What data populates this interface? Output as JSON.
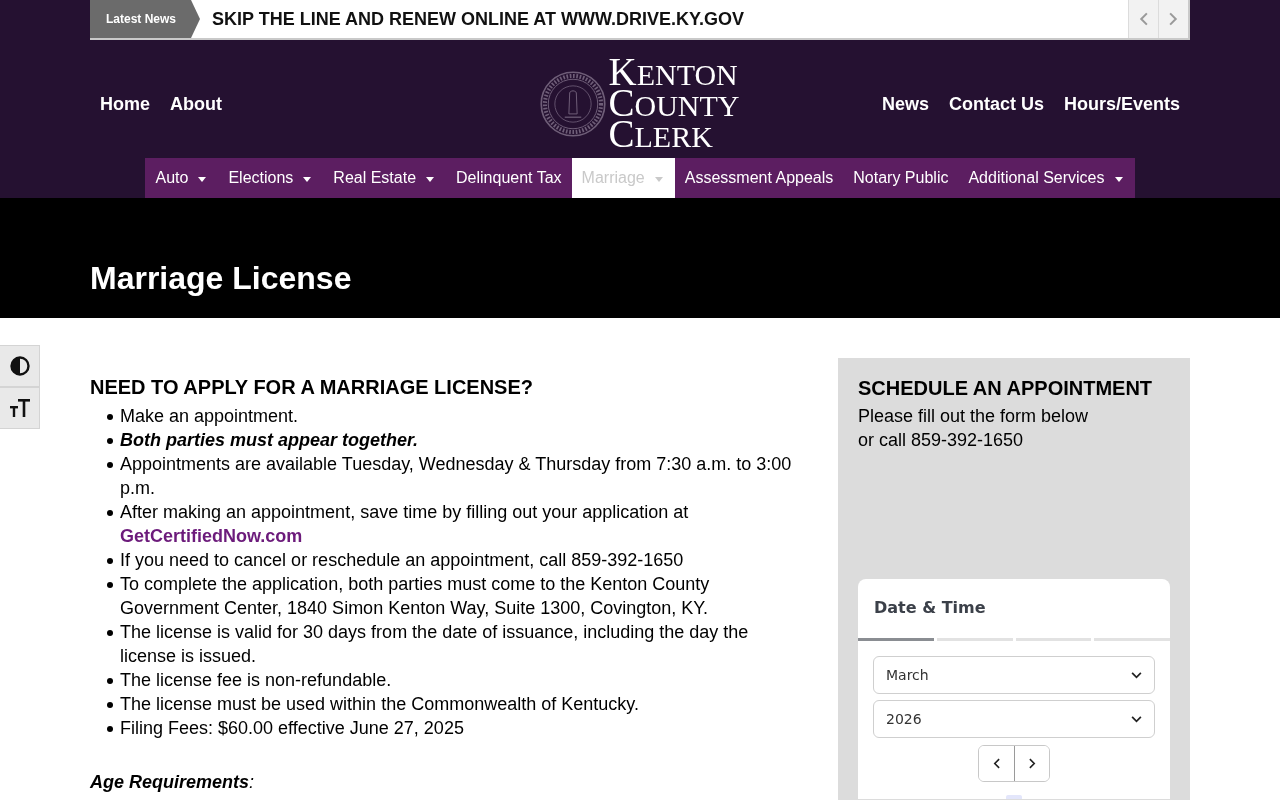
{
  "ticker": {
    "label": "Latest News",
    "headline": "SKIP THE LINE AND RENEW ONLINE AT WWW.DRIVE.KY.GOV"
  },
  "header": {
    "nav_left": [
      "Home",
      "About"
    ],
    "logo_lines": [
      "KENTON",
      "COUNTY",
      "CLERK"
    ],
    "nav_right": [
      "News",
      "Contact Us",
      "Hours/Events"
    ]
  },
  "menu": [
    {
      "label": "Auto",
      "has_dropdown": true,
      "selected": false
    },
    {
      "label": "Elections",
      "has_dropdown": true,
      "selected": false
    },
    {
      "label": "Real Estate",
      "has_dropdown": true,
      "selected": false
    },
    {
      "label": "Delinquent Tax",
      "has_dropdown": false,
      "selected": false
    },
    {
      "label": "Marriage",
      "has_dropdown": true,
      "selected": true
    },
    {
      "label": "Assessment Appeals",
      "has_dropdown": false,
      "selected": false
    },
    {
      "label": "Notary Public",
      "has_dropdown": false,
      "selected": false
    },
    {
      "label": "Additional Services",
      "has_dropdown": true,
      "selected": false
    }
  ],
  "page_title": "Marriage License",
  "content": {
    "heading": "NEED TO APPLY FOR A MARRIAGE LICENSE?",
    "items": [
      {
        "kind": "plain",
        "text": "Make an appointment."
      },
      {
        "kind": "emphasis",
        "text": "Both parties must appear together."
      },
      {
        "kind": "plain",
        "text": "Appointments are available Tuesday, Wednesday & Thursday from 7:30 a.m. to 3:00 p.m."
      },
      {
        "kind": "link",
        "text": "After making an appointment, save time by filling out your application at",
        "link": "GetCertifiedNow.com"
      },
      {
        "kind": "plain",
        "text": "If you need to cancel or reschedule an appointment, call 859-392-1650"
      },
      {
        "kind": "plain",
        "text": "To complete the application, both parties must come to the Kenton County Government Center, 1840 Simon Kenton Way, Suite 1300, Covington, KY."
      },
      {
        "kind": "plain",
        "text": "The license is valid for 30 days from the date of issuance, including the day the license is issued."
      },
      {
        "kind": "plain",
        "text": "The license fee is non-refundable."
      },
      {
        "kind": "plain",
        "text": "The license must be used within the Commonwealth of Kentucky."
      },
      {
        "kind": "plain",
        "text": "Filing Fees: $60.00 effective June 27, 2025"
      }
    ],
    "subheading": "**Age Requirements**:"
  },
  "sidebar": {
    "heading": "SCHEDULE AN APPOINTMENT",
    "text": "Please fill out the form below\nor call 859-392-1650",
    "widget": {
      "title": "Date & Time",
      "steps": [
        {
          "selected": true
        },
        {
          "selected": false
        },
        {
          "selected": false
        },
        {
          "selected": false
        }
      ],
      "month": "March",
      "year": "2026"
    }
  }
}
